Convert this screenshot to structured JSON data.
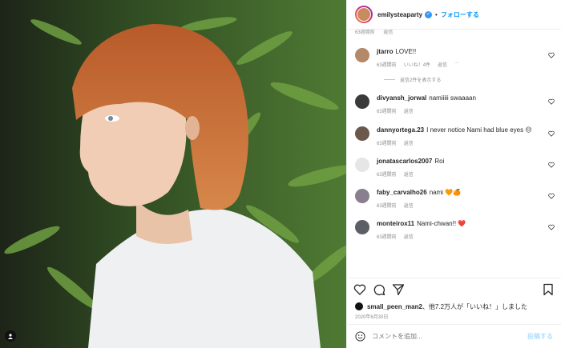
{
  "header": {
    "username": "emilysteaparty",
    "verified_icon": "verified-badge-icon",
    "separator": "•",
    "follow_label": "フォローする"
  },
  "top_meta": {
    "time": "63週間前",
    "reply": "返信"
  },
  "comments": [
    {
      "username": "jtarro",
      "text": "LOVE!!",
      "time": "63週間前",
      "likes": "いいね！4件",
      "reply": "返信",
      "more": "···",
      "avatar_color": "#b5886a"
    },
    {
      "username": "divyansh_jorwal",
      "text": "namiiiii swaaaan",
      "time": "63週間前",
      "reply": "返信",
      "avatar_color": "#3a3a3a"
    },
    {
      "username": "dannyortega.23",
      "text": "I never notice Nami had blue eyes 😔",
      "time": "63週間前",
      "reply": "返信",
      "avatar_color": "#6b5a4c"
    },
    {
      "username": "jonatascarlos2007",
      "text": "Roi",
      "time": "63週間前",
      "reply": "返信",
      "avatar_color": "#e6e6e6"
    },
    {
      "username": "faby_carvalho26",
      "text": "nami 🧡🍊",
      "time": "63週間前",
      "reply": "返信",
      "avatar_color": "#8a7f8e"
    },
    {
      "username": "monteirox11",
      "text": "Nami-chwan!! ❤️",
      "time": "63週間前",
      "reply": "返信",
      "avatar_color": "#5c5f66"
    }
  ],
  "view_replies": "返信2件を表示する",
  "likes": {
    "user": "small_peen_man2",
    "rest": "、他7.2万人が「いいね！」しました"
  },
  "date": "2020年6月30日",
  "add_comment": {
    "placeholder": "コメントを追加...",
    "post_label": "投稿する"
  }
}
